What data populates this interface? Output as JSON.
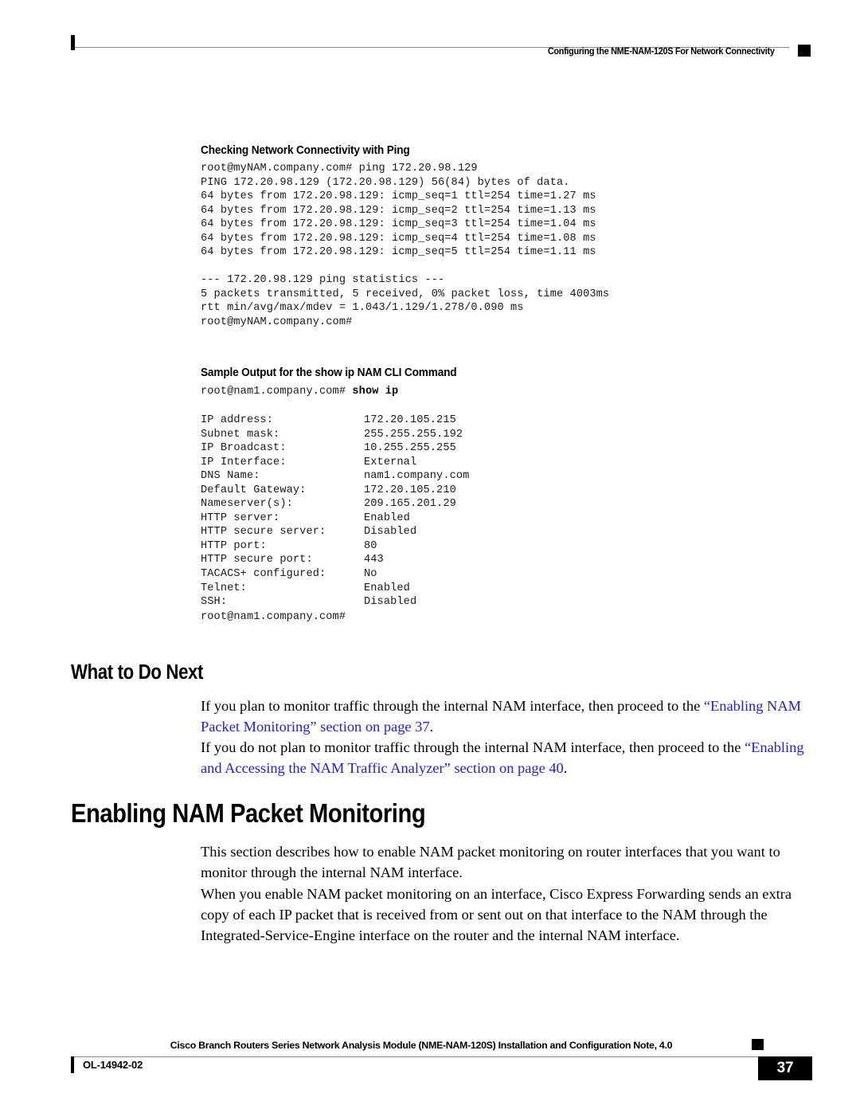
{
  "header": {
    "title": "Configuring the NME-NAM-120S For Network Connectivity"
  },
  "sections": {
    "ping": {
      "heading": "Checking Network Connectivity with Ping",
      "output": "root@myNAM.company.com# ping 172.20.98.129\nPING 172.20.98.129 (172.20.98.129) 56(84) bytes of data.\n64 bytes from 172.20.98.129: icmp_seq=1 ttl=254 time=1.27 ms\n64 bytes from 172.20.98.129: icmp_seq=2 ttl=254 time=1.13 ms\n64 bytes from 172.20.98.129: icmp_seq=3 ttl=254 time=1.04 ms\n64 bytes from 172.20.98.129: icmp_seq=4 ttl=254 time=1.08 ms\n64 bytes from 172.20.98.129: icmp_seq=5 ttl=254 time=1.11 ms",
      "stats": "--- 172.20.98.129 ping statistics ---\n5 packets transmitted, 5 received, 0% packet loss, time 4003ms\nrtt min/avg/max/mdev = 1.043/1.129/1.278/0.090 ms\nroot@myNAM.company.com#"
    },
    "show_ip": {
      "heading": "Sample Output for the show ip NAM CLI Command",
      "prompt": "root@nam1.company.com# ",
      "command": "show ip",
      "rows": [
        {
          "key": "IP address:",
          "value": "172.20.105.215"
        },
        {
          "key": "Subnet mask:",
          "value": "255.255.255.192"
        },
        {
          "key": "IP Broadcast:",
          "value": "10.255.255.255"
        },
        {
          "key": "IP Interface:",
          "value": "External"
        },
        {
          "key": "DNS Name:",
          "value": "nam1.company.com"
        },
        {
          "key": "Default Gateway:",
          "value": "172.20.105.210"
        },
        {
          "key": "Nameserver(s):",
          "value": "209.165.201.29"
        },
        {
          "key": "HTTP server:",
          "value": "Enabled"
        },
        {
          "key": "HTTP secure server:",
          "value": "Disabled"
        },
        {
          "key": "HTTP port:",
          "value": "80"
        },
        {
          "key": "HTTP secure port:",
          "value": "443"
        },
        {
          "key": "TACACS+ configured:",
          "value": "No"
        },
        {
          "key": "Telnet:",
          "value": "Enabled"
        },
        {
          "key": "SSH:",
          "value": "Disabled"
        }
      ],
      "trailing_prompt": "root@nam1.company.com#"
    },
    "what_to_do_next": {
      "heading": "What to Do Next",
      "para1": {
        "lead": "If you plan to monitor traffic through the internal NAM interface, then proceed to the ",
        "link": "“Enabling NAM Packet Monitoring” section on page 37",
        "tail": "."
      },
      "para2": {
        "lead": "If you do not plan to monitor traffic through the internal NAM interface, then proceed to the ",
        "link": "“Enabling and Accessing the NAM Traffic Analyzer” section on page 40",
        "tail": "."
      }
    },
    "enabling": {
      "heading": "Enabling NAM Packet Monitoring",
      "para1": "This section describes how to enable NAM packet monitoring on router interfaces that you want to monitor through the internal NAM interface.",
      "para2": "When you enable NAM packet monitoring on an interface, Cisco Express Forwarding sends an extra copy of each IP packet that is received from or sent out on that interface to the NAM through the Integrated-Service-Engine interface on the router and the internal NAM interface."
    }
  },
  "footer": {
    "title": "Cisco Branch Routers Series Network Analysis Module (NME-NAM-120S) Installation and Configuration Note, 4.0",
    "doc_id": "OL-14942-02",
    "page_number": "37"
  },
  "colors": {
    "link": "#2121d6",
    "rule": "#8d8d8d",
    "ink": "#000000"
  }
}
